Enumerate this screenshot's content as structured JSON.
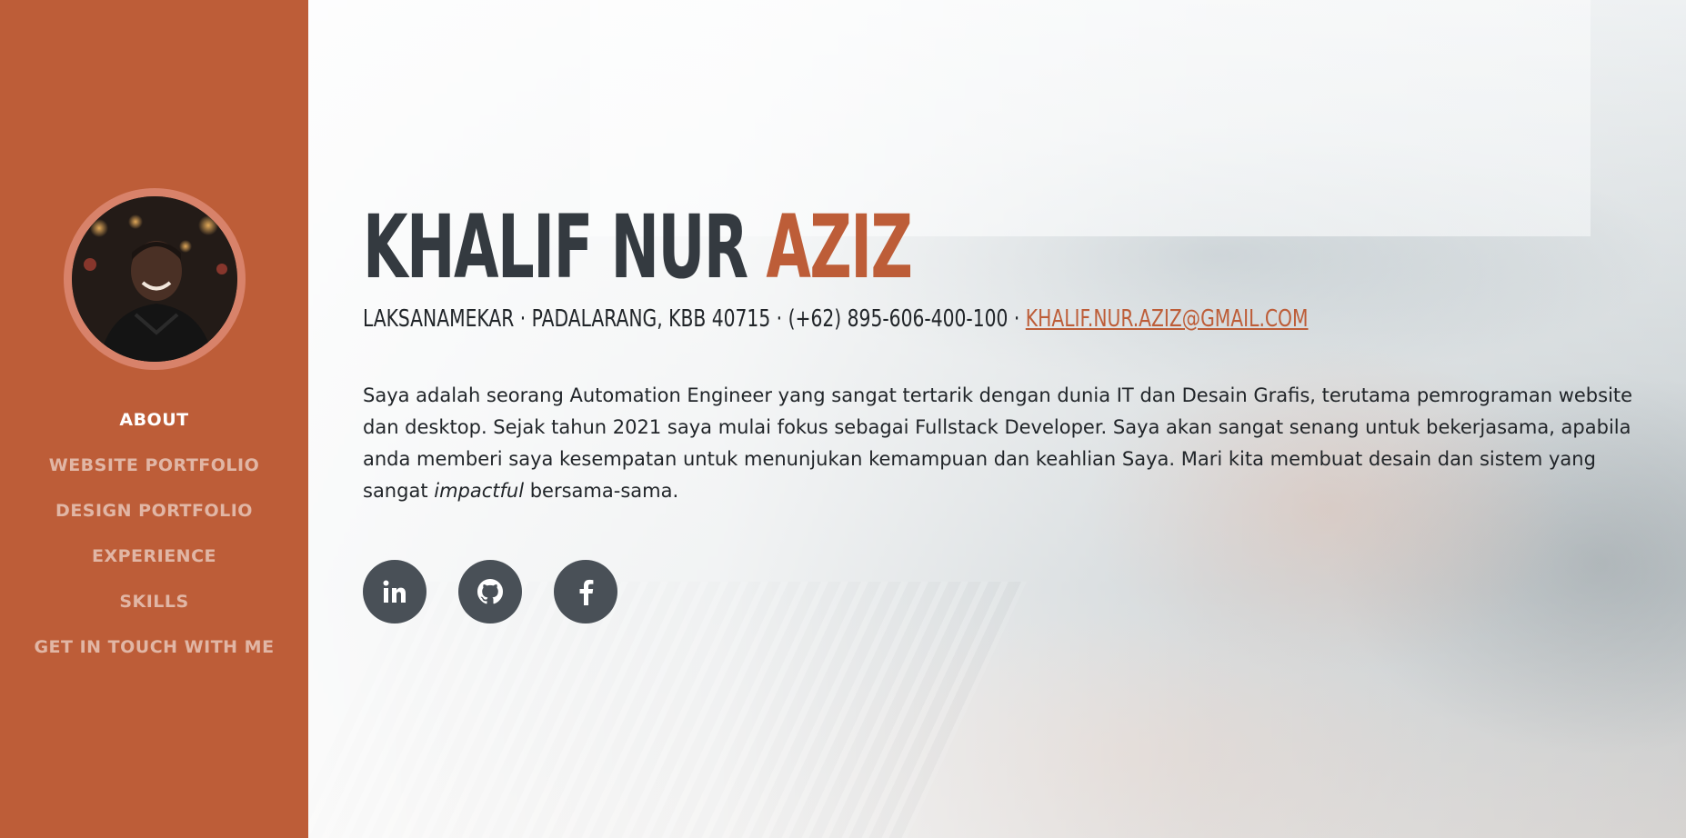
{
  "sidebar": {
    "accent_color": "#bd5d38",
    "nav": [
      {
        "label": "ABOUT",
        "active": true
      },
      {
        "label": "WEBSITE PORTFOLIO",
        "active": false
      },
      {
        "label": "DESIGN PORTFOLIO",
        "active": false
      },
      {
        "label": "EXPERIENCE",
        "active": false
      },
      {
        "label": "SKILLS",
        "active": false
      },
      {
        "label": "GET IN TOUCH WITH ME",
        "active": false
      }
    ]
  },
  "about": {
    "name_first": "KHALIF NUR ",
    "name_last": "AZIZ",
    "address": "LAKSANAMEKAR · PADALARANG, KBB 40715 · (+62) 895-606-400-100 · ",
    "email": "KHALIF.NUR.AZIZ@GMAIL.COM",
    "lead_before": "Saya adalah seorang Automation Engineer yang sangat tertarik dengan dunia IT dan Desain Grafis, terutama pemrograman website dan desktop. Sejak tahun 2021 saya mulai fokus sebagai Fullstack Developer. Saya akan sangat senang untuk bekerjasama, apabila anda memberi saya kesempatan untuk menunjukan kemampuan dan keahlian Saya. Mari kita membuat desain dan sistem yang sangat ",
    "lead_emphasis": "impactful",
    "lead_after": " bersama-sama."
  },
  "social": [
    {
      "icon": "linkedin-icon"
    },
    {
      "icon": "github-icon"
    },
    {
      "icon": "facebook-icon"
    }
  ]
}
